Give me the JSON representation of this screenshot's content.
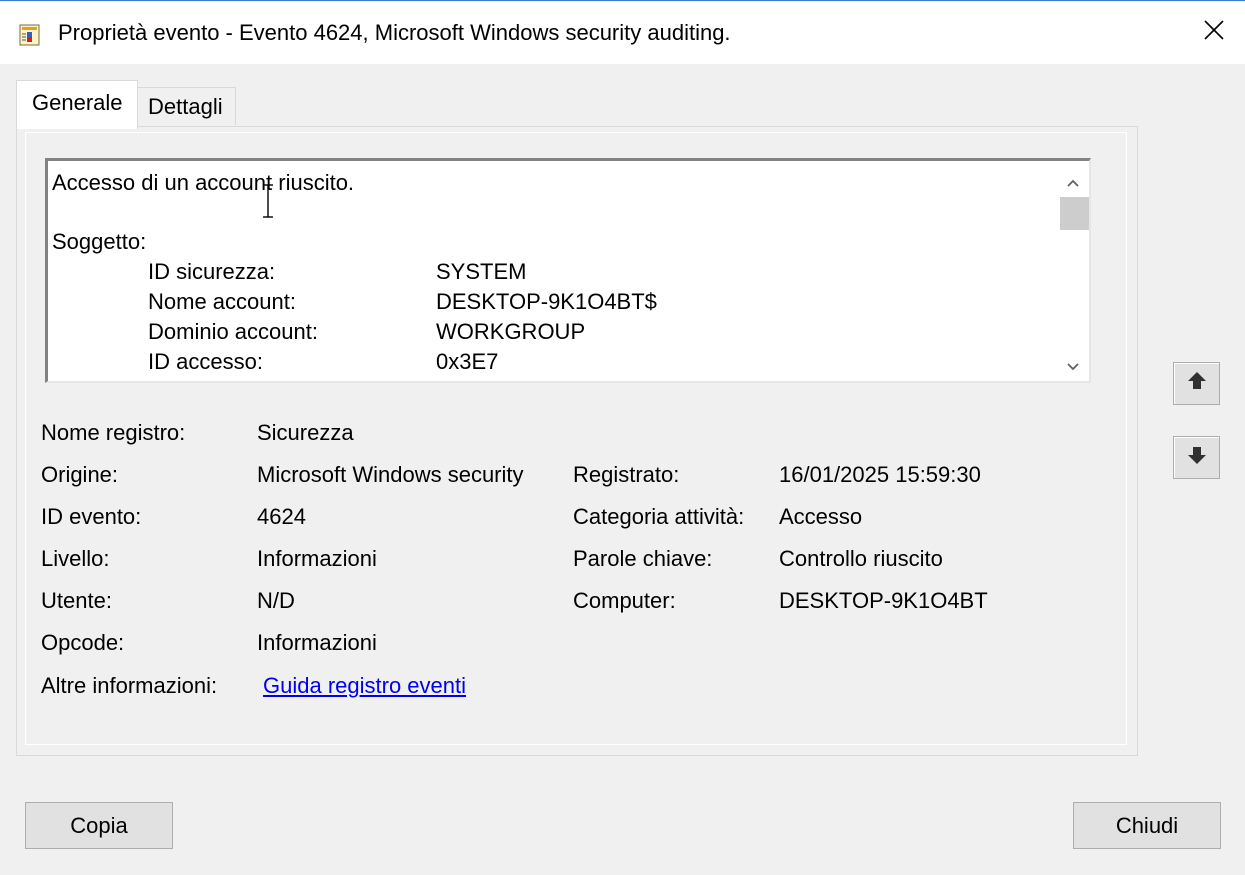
{
  "window": {
    "title": "Proprietà evento - Evento 4624, Microsoft Windows security auditing.",
    "app_icon": "event-viewer-icon",
    "close_icon": "close-icon"
  },
  "tabs": [
    {
      "label": "Generale",
      "active": true
    },
    {
      "label": "Dettagli",
      "active": false
    }
  ],
  "description": {
    "heading": "Accesso di un account riuscito.",
    "section": "Soggetto:",
    "fields": [
      {
        "label": "ID sicurezza:",
        "value": "SYSTEM"
      },
      {
        "label": "Nome account:",
        "value": "DESKTOP-9K1O4BT$"
      },
      {
        "label": "Dominio account:",
        "value": "WORKGROUP"
      },
      {
        "label": "ID accesso:",
        "value": "0x3E7"
      }
    ]
  },
  "properties": {
    "log_name": {
      "label": "Nome registro:",
      "value": "Sicurezza"
    },
    "source": {
      "label": "Origine:",
      "value": "Microsoft Windows security"
    },
    "logged": {
      "label": "Registrato:",
      "value": "16/01/2025 15:59:30"
    },
    "event_id": {
      "label": "ID evento:",
      "value": "4624"
    },
    "task_category": {
      "label": "Categoria attività:",
      "value": "Accesso"
    },
    "level": {
      "label": "Livello:",
      "value": "Informazioni"
    },
    "keywords": {
      "label": "Parole chiave:",
      "value": "Controllo riuscito"
    },
    "user": {
      "label": "Utente:",
      "value": "N/D"
    },
    "computer": {
      "label": "Computer:",
      "value": "DESKTOP-9K1O4BT"
    },
    "opcode": {
      "label": "Opcode:",
      "value": "Informazioni"
    },
    "more_info": {
      "label": "Altre informazioni:",
      "link": "Guida registro eventi"
    }
  },
  "buttons": {
    "copy": "Copia",
    "close": "Chiudi"
  }
}
